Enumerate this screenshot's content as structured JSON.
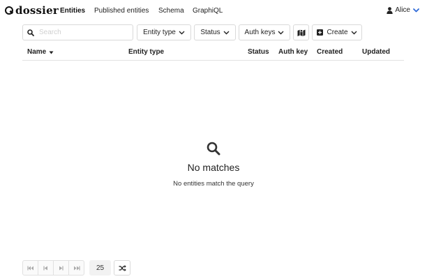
{
  "app": {
    "logo_text": "dossier"
  },
  "nav": {
    "items": [
      {
        "label": "Entities",
        "active": true
      },
      {
        "label": "Published entities",
        "active": false
      },
      {
        "label": "Schema",
        "active": false
      },
      {
        "label": "GraphiQL",
        "active": false
      }
    ],
    "user": {
      "name": "Alice",
      "icon": "user-icon"
    }
  },
  "toolbar": {
    "search_placeholder": "Search",
    "entity_type_label": "Entity type",
    "status_label": "Status",
    "auth_keys_label": "Auth keys",
    "map_icon": "map-icon",
    "create_label": "Create"
  },
  "table": {
    "columns": [
      "Name",
      "Entity type",
      "Status",
      "Auth key",
      "Created",
      "Updated"
    ],
    "sort_indicator": "caret-down"
  },
  "empty_state": {
    "icon": "search-icon",
    "title": "No matches",
    "subtitle": "No entities match the query"
  },
  "pagination": {
    "page_size": "25",
    "buttons": [
      "first-page-icon",
      "previous-page-icon",
      "next-page-icon",
      "last-page-icon"
    ],
    "shuffle_icon": "shuffle-icon"
  },
  "colors": {
    "accent": "#2f6bd8",
    "text": "#222222",
    "border": "#d9d9d9"
  }
}
